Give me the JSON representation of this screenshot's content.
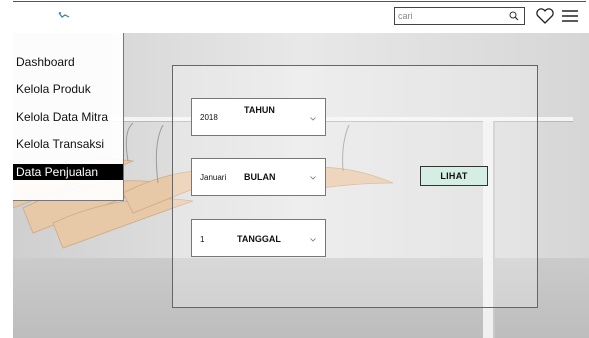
{
  "header": {
    "search": {
      "placeholder": "cari",
      "icon": "search-icon"
    },
    "icons": [
      "logo-icon",
      "heart-icon",
      "hamburger-menu-icon"
    ]
  },
  "sidebar": {
    "items": [
      {
        "label": "Dashboard",
        "active": false
      },
      {
        "label": "Kelola Produk",
        "active": false
      },
      {
        "label": "Kelola Data Mitra",
        "active": false
      },
      {
        "label": "Kelola Transaksi",
        "active": false
      },
      {
        "label": "Data Penjualan",
        "active": true
      }
    ]
  },
  "filters": {
    "tahun": {
      "label": "TAHUN",
      "value": "2018"
    },
    "bulan": {
      "label": "BULAN",
      "value": "Januari"
    },
    "tanggal": {
      "label": "TANGGAL",
      "value": "1"
    }
  },
  "actions": {
    "lihat_label": "LIHAT"
  },
  "colors": {
    "lihat_button": "#d4eee4",
    "active_item": "#000000",
    "logo": "#3c7fa8"
  }
}
